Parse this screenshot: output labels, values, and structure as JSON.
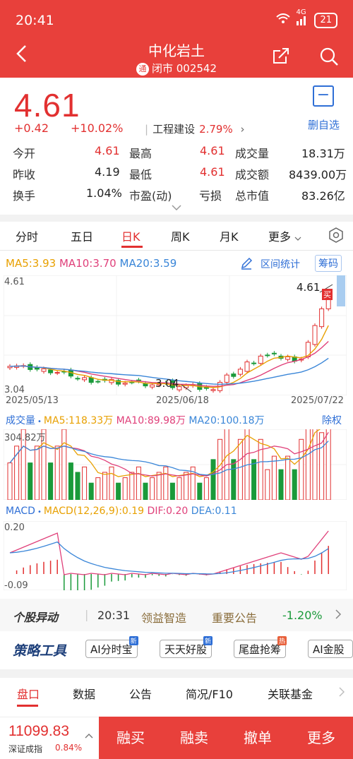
{
  "status": {
    "time": "20:41",
    "network": "4G",
    "battery": "21"
  },
  "header": {
    "title": "中化岩土",
    "tong_badge": "通",
    "subtitle": "闭市 002542"
  },
  "quote": {
    "price": "4.61",
    "change": "+0.42",
    "change_pct": "+10.02%",
    "sector_name": "工程建设",
    "sector_pct": "2.79%",
    "sector_chevron": "›",
    "fav_label": "删自选"
  },
  "stats": {
    "open_label": "今开",
    "open": "4.61",
    "high_label": "最高",
    "high": "4.61",
    "vol_label": "成交量",
    "vol": "18.31万",
    "prev_label": "昨收",
    "prev": "4.19",
    "low_label": "最低",
    "low": "4.61",
    "amt_label": "成交额",
    "amt": "8439.00万",
    "turn_label": "换手",
    "turn": "1.04%",
    "pe_label": "市盈(动)",
    "pe": "亏损",
    "mcap_label": "总市值",
    "mcap": "83.26亿"
  },
  "tabs": [
    "分时",
    "五日",
    "日K",
    "周K",
    "月K",
    "更多"
  ],
  "ma": {
    "ma5": "MA5:3.93",
    "ma10": "MA10:3.70",
    "ma20": "MA20:3.59"
  },
  "tools": {
    "range_stat": "区间统计",
    "chip": "筹码"
  },
  "kline": {
    "y_top": "4.61",
    "y_bottom": "3.04",
    "high_label": "4.61",
    "low_label": "3.04",
    "buy_tag": "买",
    "x_labels": [
      "2025/05/13",
      "2025/06/18",
      "2025/07/22"
    ]
  },
  "volume": {
    "title": "成交量",
    "ma5": "MA5:118.33万",
    "ma10": "MA10:89.98万",
    "ma20": "MA20:100.18万",
    "right": "除权",
    "y_top": "304.82万"
  },
  "macd": {
    "title": "MACD",
    "params": "MACD(12,26,9):0.19",
    "dif": "DIF:0.20",
    "dea": "DEA:0.11",
    "y_top": "0.20",
    "y_bottom": "-0.09"
  },
  "news": {
    "logo": "个股异动",
    "time": "20:31",
    "tag": "领益智造",
    "title": "重要公告",
    "pct": "-1.20%"
  },
  "strategy": {
    "logo": "策略工具",
    "chips": [
      {
        "label": "AI分时宝",
        "tag": "新"
      },
      {
        "label": "天天好股",
        "tag": "新"
      },
      {
        "label": "尾盘抢筹",
        "tag": "热"
      },
      {
        "label": "AI金股",
        "tag": ""
      }
    ]
  },
  "bottom_tabs": [
    "盘口",
    "数据",
    "公告",
    "简况/F10",
    "关联基金"
  ],
  "footer": {
    "index_value": "11099.83",
    "index_name": "深证成指",
    "index_pct": "0.84%",
    "actions": [
      "融买",
      "融卖",
      "撤单",
      "更多"
    ]
  },
  "colors": {
    "brand": "#e8403b",
    "up": "#e23030",
    "down": "#1a9a3a",
    "link": "#2f6fd6"
  }
}
